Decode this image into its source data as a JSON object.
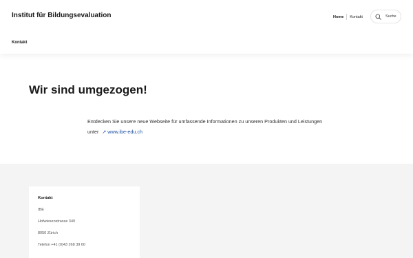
{
  "header": {
    "site_title": "Institut für Bildungsevaluation",
    "nav": {
      "kontakt": "Kontakt"
    },
    "top_links": {
      "home": "Home",
      "kontakt": "Kontakt"
    },
    "search": {
      "label": "Suche",
      "icon": "search-icon"
    }
  },
  "main": {
    "title": "Wir sind umgezogen!",
    "intro_text": "Entdecken Sie unsere neue Webseite für umfassende Informationen zu unseren Produkten und Leistungen unter",
    "link_icon": "external-link-icon",
    "link_text": "www.ibe-edu.ch",
    "link_color": "#1a4fa0"
  },
  "footer": {
    "background": "#f4f4f4",
    "card": {
      "title": "Kontakt",
      "org": "IBE",
      "street": "Hofwiesenstrasse 349",
      "city": "8050 Zürich",
      "phone": "Telefon +41 (0)43 268 39 60"
    }
  }
}
